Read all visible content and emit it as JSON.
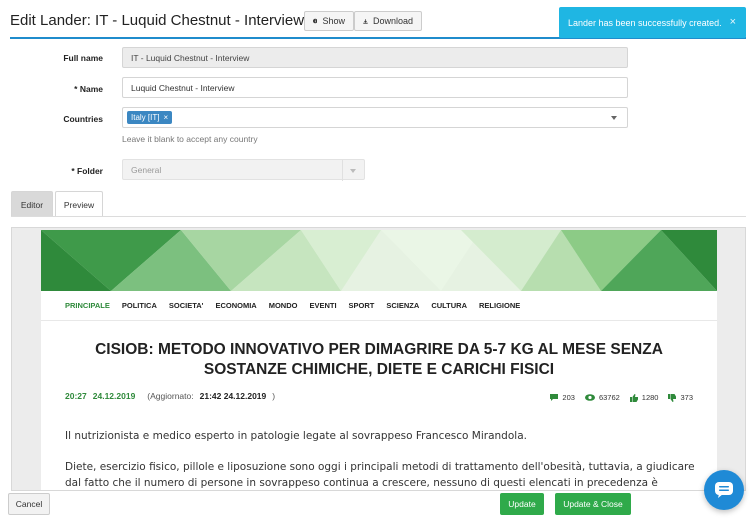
{
  "header": {
    "title": "Edit Lander: IT - Luquid Chestnut - Interview",
    "show_label": "Show",
    "download_label": "Download"
  },
  "toast": {
    "message": "Lander has been successfully created.",
    "close": "×"
  },
  "form": {
    "full_name_label": "Full name",
    "full_name_value": "IT - Luquid Chestnut - Interview",
    "name_label": "* Name",
    "name_value": "Luquid Chestnut - Interview",
    "countries_label": "Countries",
    "countries_tag": "Italy [IT]",
    "countries_tag_remove": "×",
    "countries_hint": "Leave it blank to accept any country",
    "folder_label": "* Folder",
    "folder_value": "General"
  },
  "tabs": [
    {
      "label": "Editor",
      "active": false
    },
    {
      "label": "Preview",
      "active": true
    }
  ],
  "preview": {
    "nav": [
      "PRINCIPALE",
      "POLITICA",
      "SOCIETA'",
      "ECONOMIA",
      "MONDO",
      "EVENTI",
      "SPORT",
      "SCIENZA",
      "CULTURA",
      "RELIGIONE"
    ],
    "headline": "CISIOB: METODO INNOVATIVO PER DIMAGRIRE DA 5-7 KG AL MESE SENZA SOSTANZE CHIMICHE, DIETE E CARICHI FISICI",
    "time": "20:27",
    "date": "24.12.2019",
    "updated_prefix": "(Aggiornato:",
    "updated_value": "21:42 24.12.2019",
    "updated_suffix": ")",
    "stats": {
      "comments": "203",
      "views": "63762",
      "likes": "1280",
      "dislikes": "373"
    },
    "paragraph1": "Il nutrizionista e medico esperto in patologie legate al sovrappeso Francesco Mirandola.",
    "paragraph2": "Diete, esercizio fisico, pillole e liposuzione sono oggi i principali metodi di trattamento dell'obesità, tuttavia, a giudicare dal fatto che il numero di persone in sovrappeso continua a crescere, nessuno di questi elencati in precedenza è"
  },
  "footer": {
    "cancel_label": "Cancel",
    "update_label": "Update",
    "update_close_label": "Update & Close"
  },
  "colors": {
    "accent": "#1f8ccc",
    "toast": "#1fb6e3",
    "success": "#2faa4a",
    "site_green": "#2f8a3b"
  }
}
